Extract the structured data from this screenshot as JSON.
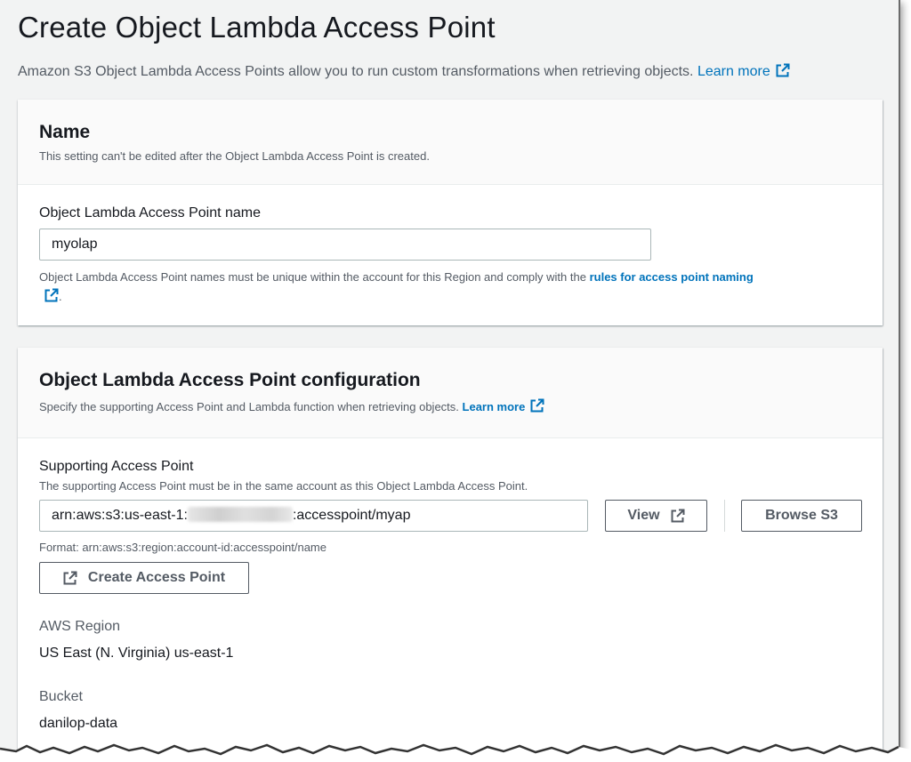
{
  "page": {
    "title": "Create Object Lambda Access Point",
    "description": "Amazon S3 Object Lambda Access Points allow you to run custom transformations when retrieving objects.",
    "learn_more": "Learn more"
  },
  "name_panel": {
    "title": "Name",
    "subtitle": "This setting can't be edited after the Object Lambda Access Point is created.",
    "field_label": "Object Lambda Access Point name",
    "field_value": "myolap",
    "hint_prefix": "Object Lambda Access Point names must be unique within the account for this Region and comply with the",
    "hint_link": "rules for access point naming",
    "hint_suffix": "."
  },
  "config_panel": {
    "title": "Object Lambda Access Point configuration",
    "subtitle": "Specify the supporting Access Point and Lambda function when retrieving objects.",
    "learn_more": "Learn more",
    "supporting_label": "Supporting Access Point",
    "supporting_desc": "The supporting Access Point must be in the same account as this Object Lambda Access Point.",
    "arn_prefix": "arn:aws:s3:us-east-1:",
    "arn_suffix": ":accesspoint/myap",
    "view_button": "View",
    "browse_button": "Browse S3",
    "format_hint": "Format: arn:aws:s3:region:account-id:accesspoint/name",
    "create_button": "Create Access Point",
    "region_label": "AWS Region",
    "region_value": "US East (N. Virginia) us-east-1",
    "bucket_label": "Bucket",
    "bucket_value": "danilop-data"
  },
  "colors": {
    "link": "#0073bb",
    "text": "#16191f",
    "muted": "#545b64",
    "background": "#f2f3f3"
  }
}
